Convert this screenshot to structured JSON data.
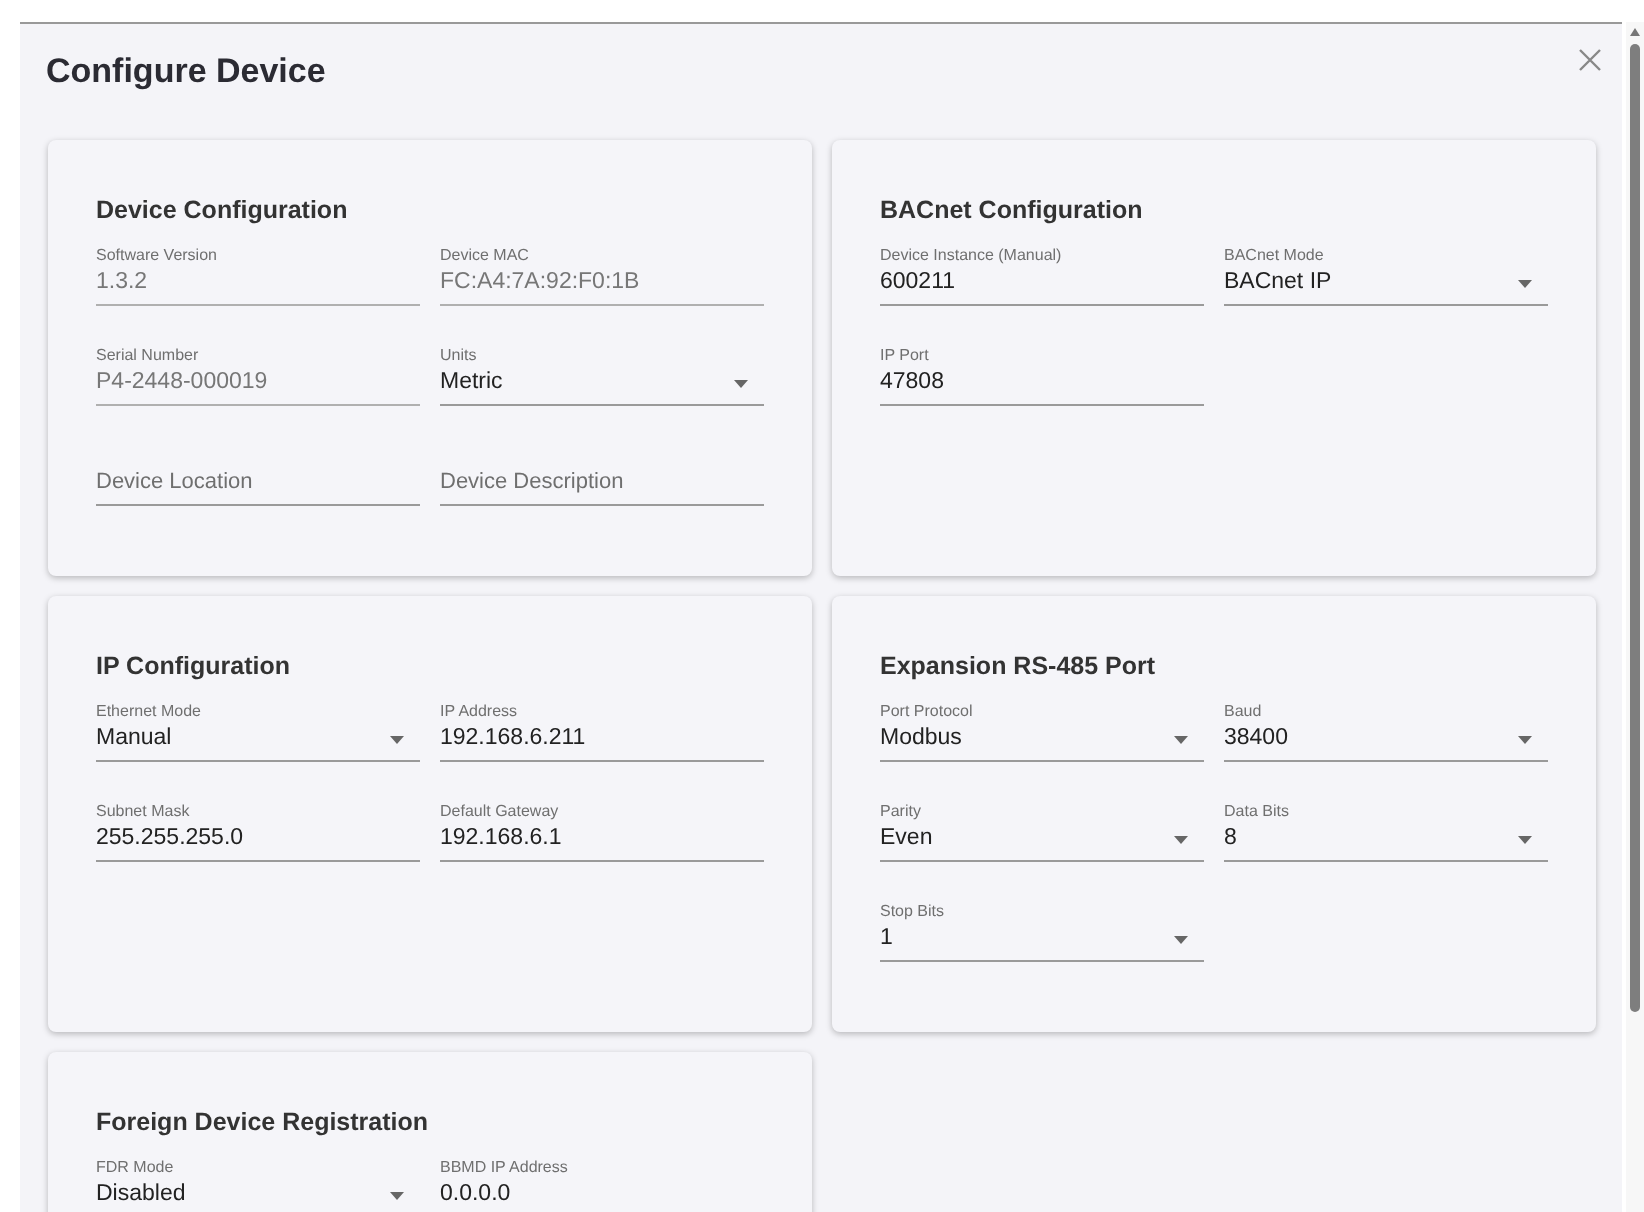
{
  "dialog": {
    "title": "Configure Device"
  },
  "cards": [
    {
      "title": "Device Configuration",
      "fields": [
        {
          "kind": "text",
          "label": "Software Version",
          "value": "1.3.2",
          "disabled": true
        },
        {
          "kind": "text",
          "label": "Device MAC",
          "value": "FC:A4:7A:92:F0:1B",
          "disabled": true
        },
        {
          "kind": "text",
          "label": "Serial Number",
          "value": "P4-2448-000019",
          "disabled": true
        },
        {
          "kind": "select",
          "label": "Units",
          "value": "Metric",
          "disabled": false
        },
        {
          "kind": "text",
          "placeholder": "Device Location"
        },
        {
          "kind": "text",
          "placeholder": "Device Description"
        }
      ]
    },
    {
      "title": "BACnet Configuration",
      "fields": [
        {
          "kind": "text",
          "label": "Device Instance (Manual)",
          "value": "600211",
          "disabled": false
        },
        {
          "kind": "select",
          "label": "BACnet Mode",
          "value": "BACnet IP",
          "disabled": false
        },
        {
          "kind": "text",
          "label": "IP Port",
          "value": "47808",
          "disabled": false
        }
      ]
    },
    {
      "title": "IP Configuration",
      "fields": [
        {
          "kind": "select",
          "label": "Ethernet Mode",
          "value": "Manual",
          "disabled": false
        },
        {
          "kind": "text",
          "label": "IP Address",
          "value": "192.168.6.211",
          "disabled": false
        },
        {
          "kind": "text",
          "label": "Subnet Mask",
          "value": "255.255.255.0",
          "disabled": false
        },
        {
          "kind": "text",
          "label": "Default Gateway",
          "value": "192.168.6.1",
          "disabled": false
        }
      ]
    },
    {
      "title": "Expansion RS-485 Port",
      "fields": [
        {
          "kind": "select",
          "label": "Port Protocol",
          "value": "Modbus",
          "disabled": false
        },
        {
          "kind": "select",
          "label": "Baud",
          "value": "38400",
          "disabled": false
        },
        {
          "kind": "select",
          "label": "Parity",
          "value": "Even",
          "disabled": false
        },
        {
          "kind": "select",
          "label": "Data Bits",
          "value": "8",
          "disabled": false
        },
        {
          "kind": "select",
          "label": "Stop Bits",
          "value": "1",
          "disabled": false
        }
      ]
    },
    {
      "title": "Foreign Device Registration",
      "fields": [
        {
          "kind": "select",
          "label": "FDR Mode",
          "value": "Disabled",
          "disabled": false
        },
        {
          "kind": "text",
          "label": "BBMD IP Address",
          "value": "0.0.0.0",
          "disabled": false
        }
      ]
    }
  ]
}
